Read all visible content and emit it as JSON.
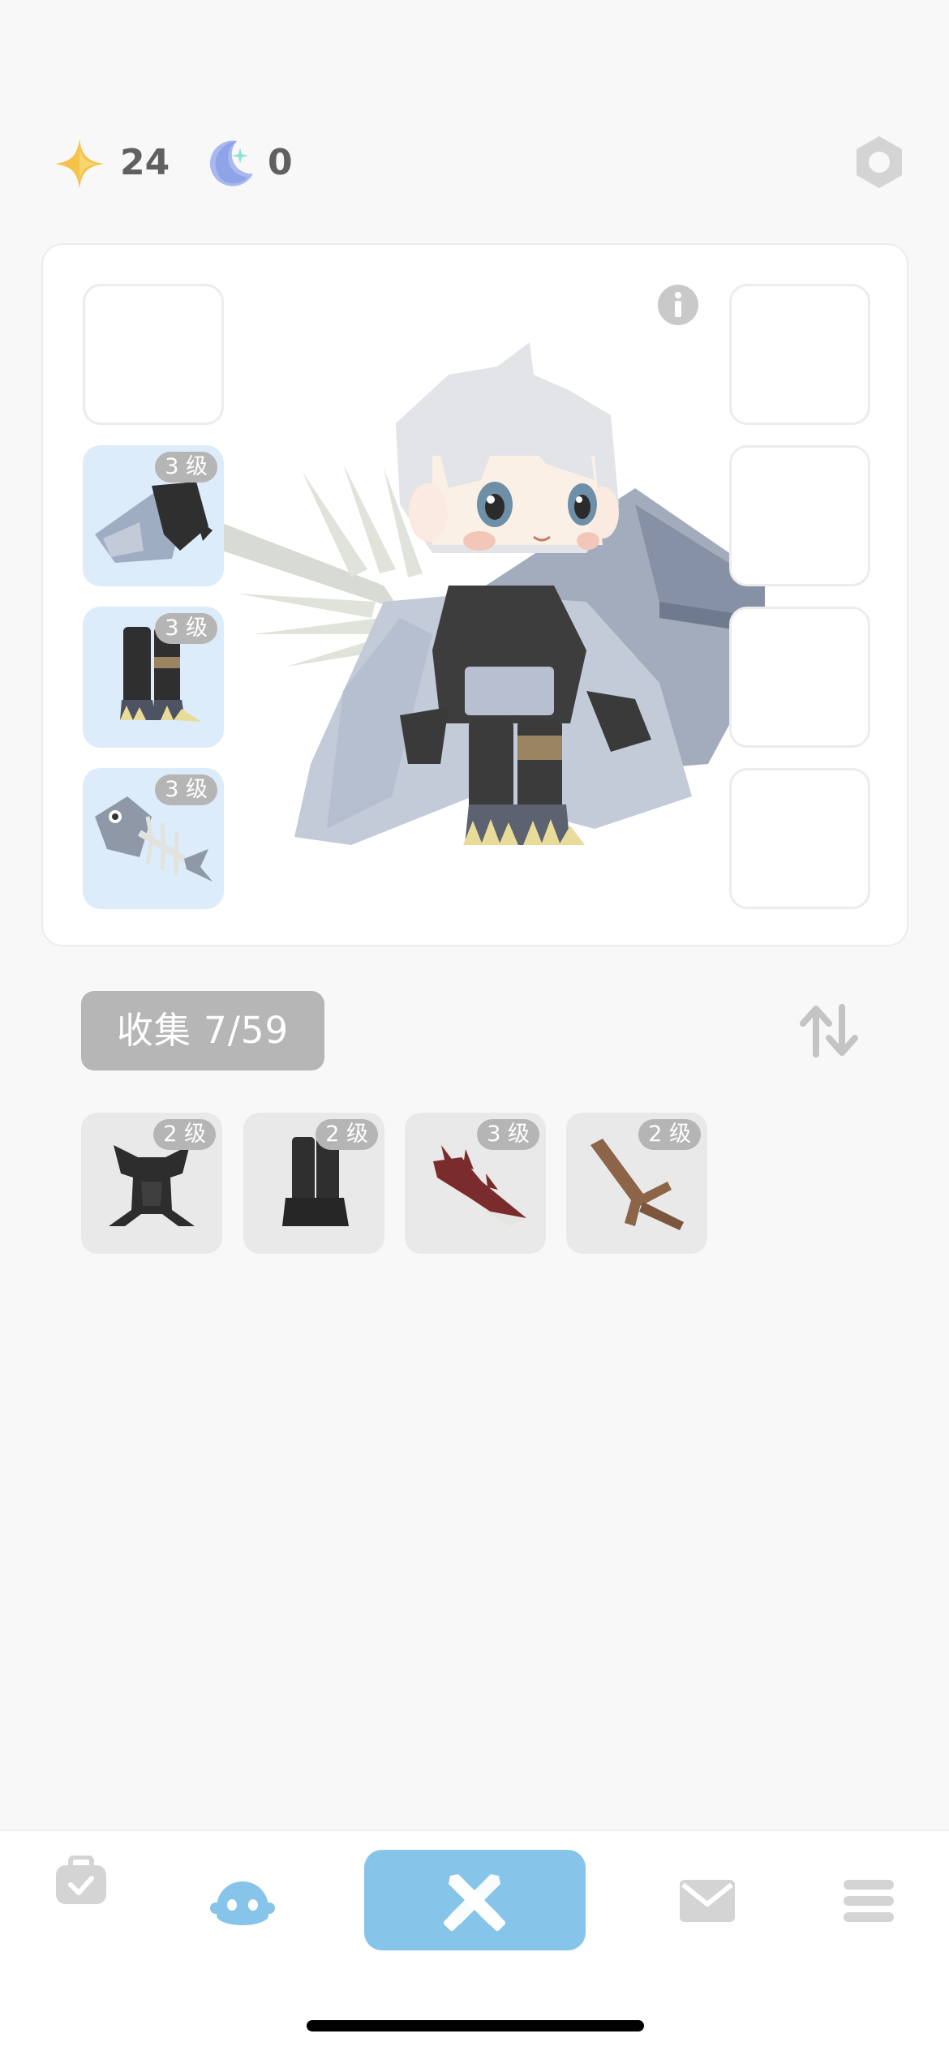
{
  "currency": {
    "stars_value": "24",
    "moons_value": "0"
  },
  "equipment": {
    "left_slots": [
      {
        "level": ""
      },
      {
        "level": "3 级"
      },
      {
        "level": "3 级"
      },
      {
        "level": "3 级"
      }
    ]
  },
  "collection": {
    "button_label": "收集 7/59"
  },
  "inventory": [
    {
      "icon": "dark-armor-icon",
      "level": "2 级"
    },
    {
      "icon": "black-boots-icon",
      "level": "2 级"
    },
    {
      "icon": "red-spike-weapon-icon",
      "level": "3 级"
    },
    {
      "icon": "branch-weapon-icon",
      "level": "2 级"
    }
  ],
  "nav": {
    "items": [
      "bag-icon",
      "character-icon",
      "battle-icon",
      "mail-icon",
      "menu-icon"
    ],
    "active_color": "#86c4e9"
  }
}
